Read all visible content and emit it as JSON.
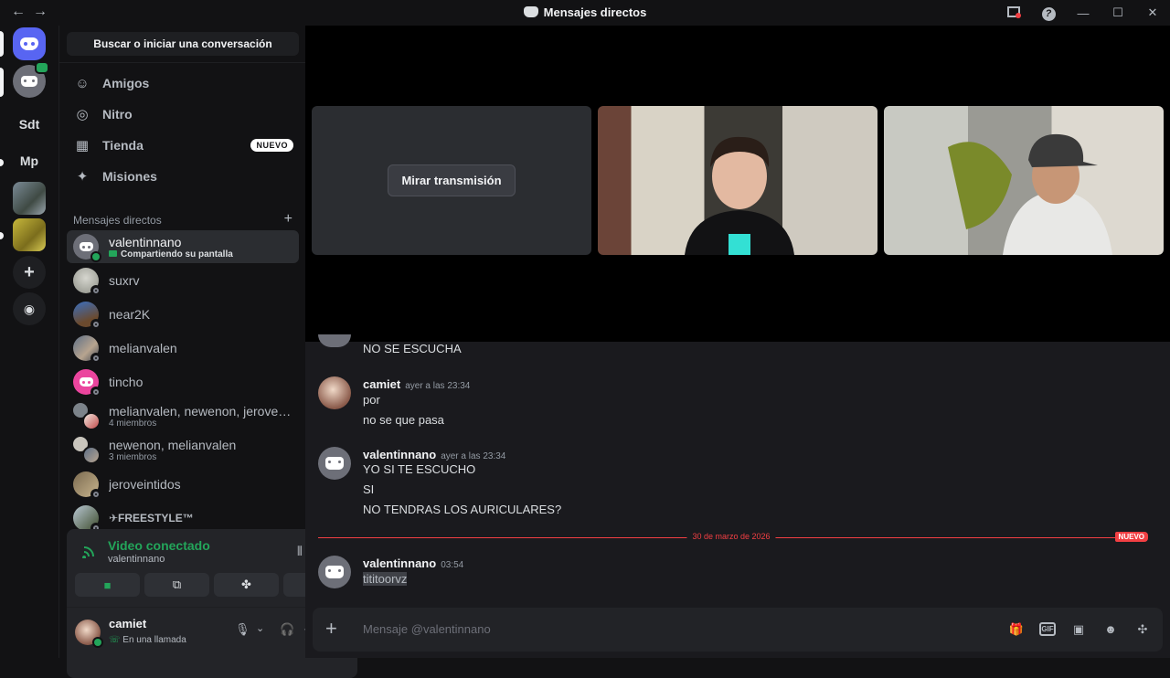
{
  "window": {
    "title": "Mensajes directos",
    "back_icon": "←",
    "forward_icon": "→",
    "help_icon": "?",
    "minimize_icon": "—",
    "maximize_icon": "☐",
    "close_icon": "✕"
  },
  "rail": {
    "servers": [
      {
        "label": ""
      },
      {
        "label": ""
      },
      {
        "label": "Sdt"
      },
      {
        "label": "Mp"
      },
      {
        "label": ""
      },
      {
        "label": ""
      }
    ],
    "add_icon": "+",
    "explore_icon": "◉"
  },
  "sidebar": {
    "search_label": "Buscar o iniciar una conversación",
    "nav": [
      {
        "label": "Amigos",
        "icon": "☺"
      },
      {
        "label": "Nitro",
        "icon": "◎"
      },
      {
        "label": "Tienda",
        "icon": "▦",
        "badge": "NUEVO"
      },
      {
        "label": "Misiones",
        "icon": "✦"
      }
    ],
    "section_title": "Mensajes directos",
    "section_add": "+",
    "dms": [
      {
        "name": "valentinnano",
        "sub": "Compartiendo su pantalla"
      },
      {
        "name": "suxrv",
        "sub": ""
      },
      {
        "name": "near2K",
        "sub": ""
      },
      {
        "name": "melianvalen",
        "sub": ""
      },
      {
        "name": "tincho",
        "sub": ""
      },
      {
        "name": "melianvalen, newenon, jerovein…",
        "sub": "4 miembros"
      },
      {
        "name": "newenon, melianvalen",
        "sub": "3 miembros"
      },
      {
        "name": "jeroveintidos",
        "sub": ""
      },
      {
        "name": "✈FREESTYLE™",
        "sub": ""
      }
    ]
  },
  "voice": {
    "status": "Video conectado",
    "channel": "valentinnano",
    "buttons": [
      {
        "icon": "■"
      },
      {
        "icon": "⧉"
      },
      {
        "icon": "✤"
      },
      {
        "icon": "✺"
      }
    ],
    "soundboard_icon": "⫴",
    "disconnect_icon": "☎"
  },
  "user": {
    "name": "camiet",
    "status": "En una llamada",
    "mic_icon": "🎙",
    "headset_icon": "🎧",
    "settings_icon": "⚙",
    "chevron_icon": "⌄"
  },
  "stage": {
    "watch_button": "Mirar transmisión"
  },
  "messages": {
    "fragment": "NO SE ESCUCHA",
    "groups": [
      {
        "author": "camiet",
        "time": "ayer a las 23:34",
        "lines": [
          "por",
          "no se que pasa"
        ]
      },
      {
        "author": "valentinnano",
        "time": "ayer a las 23:34",
        "lines": [
          "YO SI TE ESCUCHO",
          "SI",
          "NO TENDRAS LOS AURICULARES?"
        ]
      },
      {
        "author": "valentinnano",
        "time": "03:54",
        "lines": [
          "tititoorvz"
        ]
      }
    ],
    "divider_date": "30 de marzo de 2026",
    "divider_tag": "NUEVO"
  },
  "composer": {
    "placeholder": "Mensaje @valentinnano",
    "add_icon": "+",
    "gift_icon": "🎁",
    "gif_label": "GIF",
    "sticker_icon": "▣",
    "emoji_icon": "☻",
    "apps_icon": "✣"
  },
  "colors": {
    "accent": "#5865f2",
    "online": "#23a55a",
    "new_divider": "#f23f43"
  }
}
